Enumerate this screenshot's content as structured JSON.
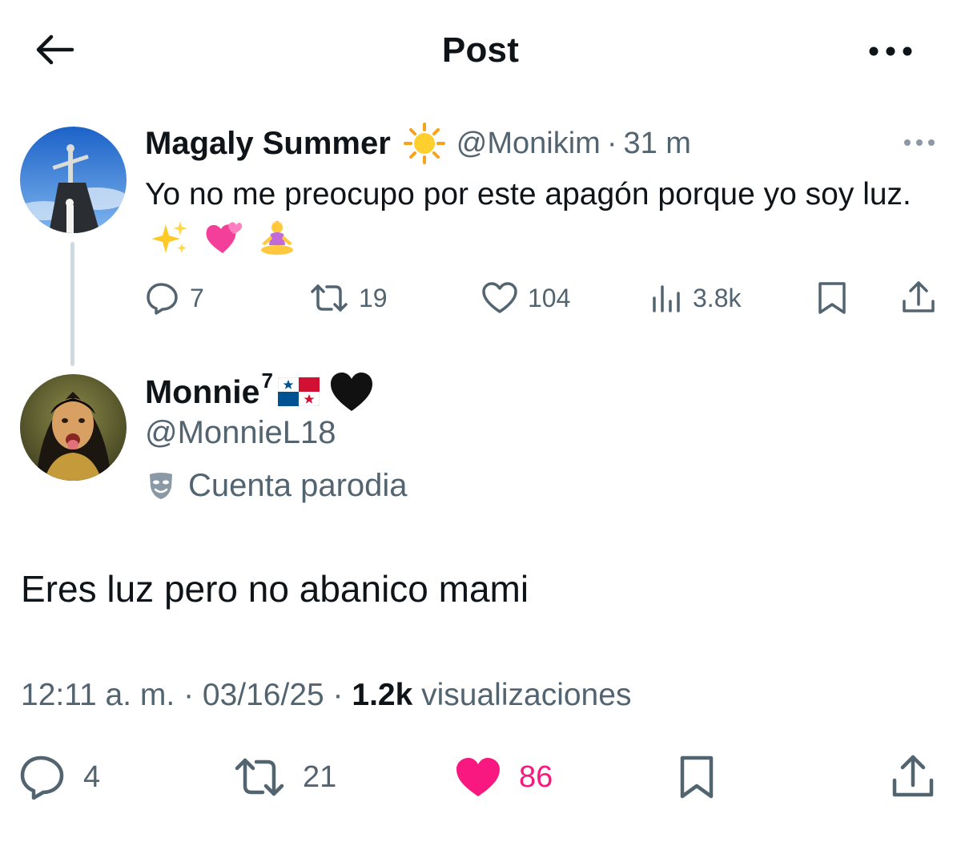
{
  "header": {
    "title": "Post",
    "back_icon": "arrow-left-icon",
    "more_icon": "more-horizontal-icon"
  },
  "parent_post": {
    "display_name": "Magaly Summer",
    "name_emoji": "sun-emoji",
    "handle": "@Monikim",
    "separator": "·",
    "time": "31 m",
    "text": "Yo no me preocupo por este apagón porque yo soy luz.",
    "text_emojis": [
      "sparkles-emoji",
      "two-hearts-emoji",
      "person-lotus-position-emoji"
    ],
    "actions": {
      "replies": "7",
      "reposts": "19",
      "likes": "104",
      "views": "3.8k"
    }
  },
  "reply_post": {
    "display_name": "Monnie",
    "name_superscript": "7",
    "name_emojis": [
      "flag-panama-emoji",
      "black-heart-emoji"
    ],
    "handle": "@MonnieL18",
    "parody_label": "Cuenta parodia",
    "text": "Eres luz pero no abanico mami",
    "meta": {
      "time": "12:11 a. m.",
      "sep1": " · ",
      "date": "03/16/25",
      "sep2": " · ",
      "views_count": "1.2k",
      "views_label": "visualizaciones"
    },
    "actions": {
      "replies": "4",
      "reposts": "21",
      "likes": "86",
      "liked": true
    }
  },
  "colors": {
    "text_primary": "#0f1419",
    "text_secondary": "#536471",
    "like_active": "#f91880",
    "thread_line": "#cfd9de"
  }
}
